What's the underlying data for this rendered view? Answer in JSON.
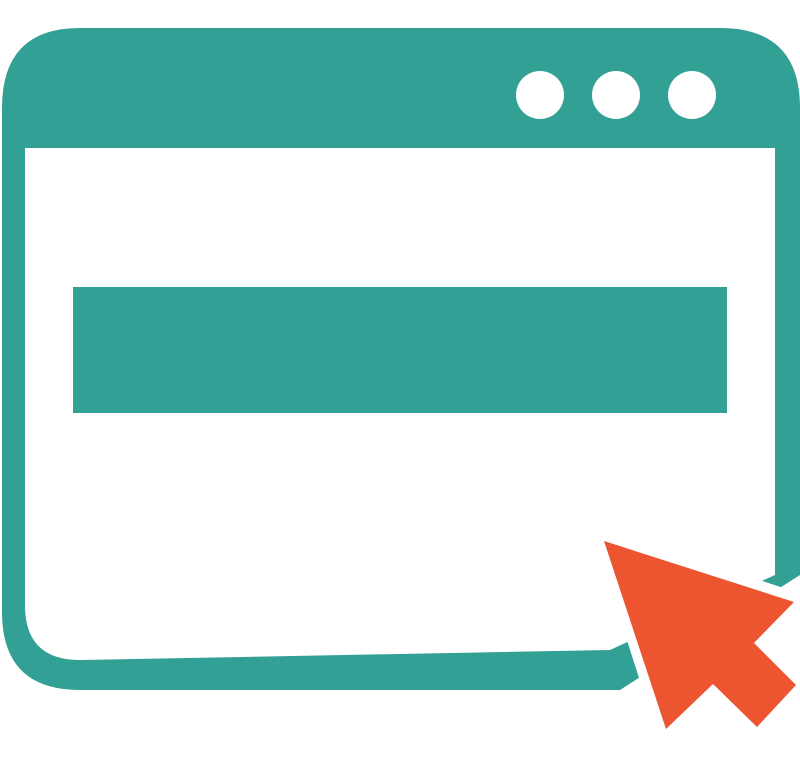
{
  "icon": {
    "name": "browser-window-click-icon",
    "colors": {
      "window": "#33a096",
      "cursor": "#ec552f",
      "background": "#ffffff",
      "content_area": "#ffffff",
      "title_dots": "#ffffff"
    },
    "title_bar": {
      "dot_count": 3
    },
    "content": {
      "bar_icon": "content-bar",
      "cursor_icon": "mouse-pointer-icon"
    }
  }
}
